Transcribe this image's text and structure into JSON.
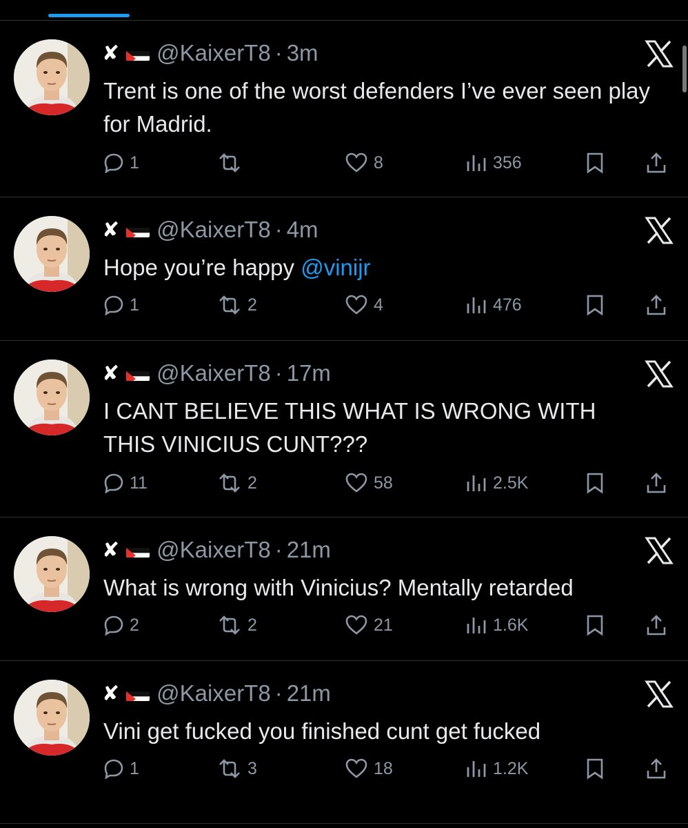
{
  "tweets": [
    {
      "handle": "@KaixerT8",
      "dot": "·",
      "time": "3m",
      "name_prefix": "✘",
      "text": "Trent is one of the worst defenders I’ve ever seen play for Madrid.",
      "mention": "",
      "replies": "1",
      "retweets": "",
      "likes": "8",
      "views": "356"
    },
    {
      "handle": "@KaixerT8",
      "dot": "·",
      "time": "4m",
      "name_prefix": "✘",
      "text": "Hope you’re happy ",
      "mention": "@vinijr",
      "replies": "1",
      "retweets": "2",
      "likes": "4",
      "views": "476"
    },
    {
      "handle": "@KaixerT8",
      "dot": "·",
      "time": "17m",
      "name_prefix": "✘",
      "text": "I CANT BELIEVE THIS WHAT IS WRONG WITH THIS VINICIUS CUNT???",
      "mention": "",
      "replies": "11",
      "retweets": "2",
      "likes": "58",
      "views": "2.5K"
    },
    {
      "handle": "@KaixerT8",
      "dot": "·",
      "time": "21m",
      "name_prefix": "✘",
      "text": "What is wrong with Vinicius? Mentally retarded",
      "mention": "",
      "replies": "2",
      "retweets": "2",
      "likes": "21",
      "views": "1.6K"
    },
    {
      "handle": "@KaixerT8",
      "dot": "·",
      "time": "21m",
      "name_prefix": "✘",
      "text": "Vini get fucked you finished cunt get fucked",
      "mention": "",
      "replies": "1",
      "retweets": "3",
      "likes": "18",
      "views": "1.2K"
    }
  ],
  "colors": {
    "background": "#000000",
    "text": "#e7e9ea",
    "muted": "#8b98a5",
    "accent": "#1d9bf0",
    "divider": "#2f3336"
  },
  "icons": {
    "brand": "x-logo-icon",
    "reply": "reply-icon",
    "retweet": "retweet-icon",
    "like": "heart-icon",
    "views": "views-icon",
    "bookmark": "bookmark-icon",
    "share": "share-icon",
    "flag": "palestine-flag-icon"
  }
}
